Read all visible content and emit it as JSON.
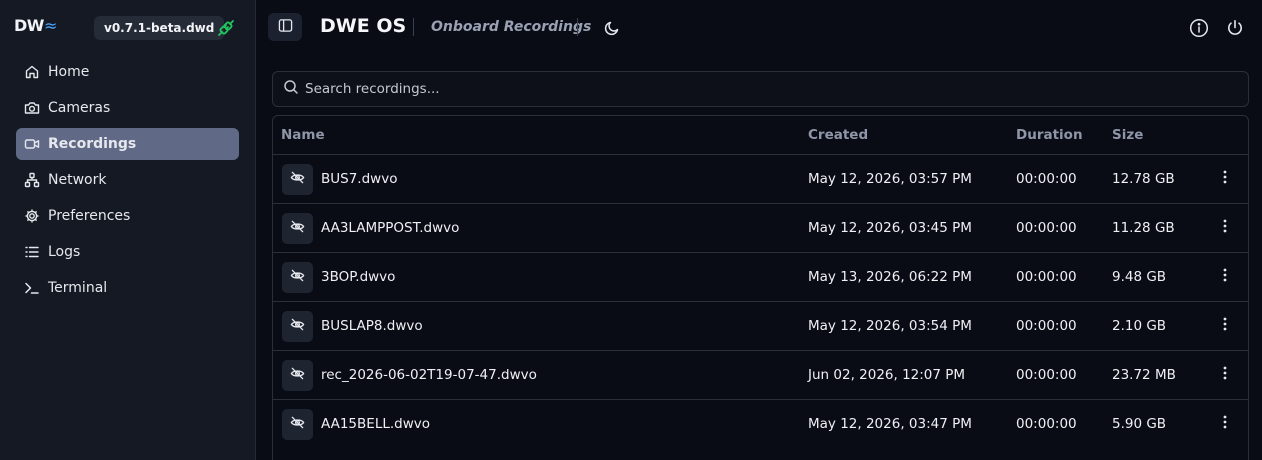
{
  "brand": {
    "logo_text": "DW",
    "logo_wave": "≈",
    "version": "v0.7.1-beta.dwd",
    "connection_icon": "plug-connected-icon",
    "connection_color": "#22c55e"
  },
  "nav": {
    "items": [
      {
        "label": "Home",
        "icon": "home-icon",
        "active": false
      },
      {
        "label": "Cameras",
        "icon": "camera-icon",
        "active": false
      },
      {
        "label": "Recordings",
        "icon": "video-icon",
        "active": true
      },
      {
        "label": "Network",
        "icon": "network-icon",
        "active": false
      },
      {
        "label": "Preferences",
        "icon": "gear-icon",
        "active": false
      },
      {
        "label": "Logs",
        "icon": "list-icon",
        "active": false
      },
      {
        "label": "Terminal",
        "icon": "terminal-icon",
        "active": false
      }
    ]
  },
  "header": {
    "title": "DWE OS",
    "subtitle": "Onboard Recordings"
  },
  "search": {
    "placeholder": "Search recordings..."
  },
  "table": {
    "columns": {
      "name": "Name",
      "created": "Created",
      "duration": "Duration",
      "size": "Size"
    },
    "rows": [
      {
        "name": "BUS7.dwvo",
        "created": "May 12, 2026, 03:57 PM",
        "duration": "00:00:00",
        "size": "12.78 GB"
      },
      {
        "name": "AA3LAMPPOST.dwvo",
        "created": "May 12, 2026, 03:45 PM",
        "duration": "00:00:00",
        "size": "11.28 GB"
      },
      {
        "name": "3BOP.dwvo",
        "created": "May 13, 2026, 06:22 PM",
        "duration": "00:00:00",
        "size": "9.48 GB"
      },
      {
        "name": "BUSLAP8.dwvo",
        "created": "May 12, 2026, 03:54 PM",
        "duration": "00:00:00",
        "size": "2.10 GB"
      },
      {
        "name": "rec_2026-06-02T19-07-47.dwvo",
        "created": "Jun 02, 2026, 12:07 PM",
        "duration": "00:00:00",
        "size": "23.72 MB"
      },
      {
        "name": "AA15BELL.dwvo",
        "created": "May 12, 2026, 03:47 PM",
        "duration": "00:00:00",
        "size": "5.90 GB"
      }
    ]
  },
  "colors": {
    "background": "#0a0c15",
    "sidebar": "#151923",
    "active_nav": "#606a86",
    "accent": "#4aa3ff"
  }
}
